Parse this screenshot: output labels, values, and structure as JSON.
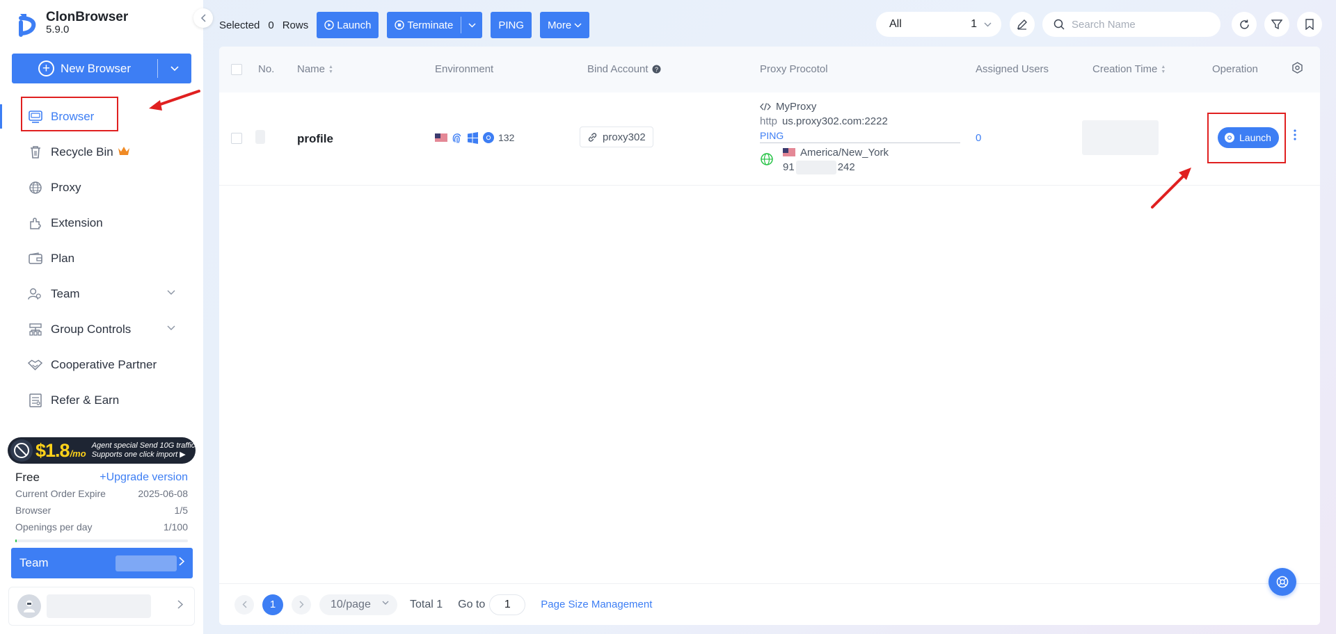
{
  "app": {
    "name": "ClonBrowser",
    "version": "5.9.0",
    "brand_color": "#3d7ef4",
    "collapse_icon": "chevron-left-icon"
  },
  "sidebar": {
    "new_browser_label": "New Browser",
    "items": [
      {
        "label": "Browser",
        "icon": "browser-icon",
        "active": true
      },
      {
        "label": "Recycle Bin",
        "icon": "trash-icon",
        "badge": "crown-icon"
      },
      {
        "label": "Proxy",
        "icon": "globe-icon"
      },
      {
        "label": "Extension",
        "icon": "puzzle-icon"
      },
      {
        "label": "Plan",
        "icon": "wallet-icon"
      },
      {
        "label": "Team",
        "icon": "team-icon",
        "expandable": true
      },
      {
        "label": "Group Controls",
        "icon": "hierarchy-icon",
        "expandable": true
      },
      {
        "label": "Cooperative Partner",
        "icon": "handshake-icon"
      },
      {
        "label": "Refer & Earn",
        "icon": "gift-icon"
      }
    ],
    "promo": {
      "price": "$1.8",
      "unit": "/mo",
      "line1": "Agent special Send 10G traffic",
      "line2": "Supports one click import ▶"
    },
    "plan": {
      "name": "Free",
      "upgrade_label": "+Upgrade version",
      "rows": [
        {
          "label": "Current Order Expire",
          "value": "2025-06-08"
        },
        {
          "label": "Browser",
          "value": "1/5"
        },
        {
          "label": "Openings per day",
          "value": "1/100"
        }
      ],
      "usage_fraction": 0.01
    },
    "team_label": "Team"
  },
  "toolbar": {
    "selected_label": "Selected",
    "selected_count": "0",
    "rows_label": "Rows",
    "launch_label": "Launch",
    "terminate_label": "Terminate",
    "ping_label": "PING",
    "more_label": "More",
    "filter_value": "All",
    "filter_count": "1",
    "search_placeholder": "Search Name"
  },
  "table": {
    "columns": {
      "no": "No.",
      "name": "Name",
      "environment": "Environment",
      "bind_account": "Bind Account",
      "proxy_protocol": "Proxy Procotol",
      "assigned_users": "Assigned Users",
      "creation_time": "Creation Time",
      "operation": "Operation"
    },
    "rows": [
      {
        "name": "profile",
        "env_version": "132",
        "bind_account": "proxy302",
        "proxy_name": "MyProxy",
        "proxy_type": "http",
        "proxy_host": "us.proxy302.com:2222",
        "ping_label": "PING",
        "timezone": "America/New_York",
        "ip_prefix": "91",
        "ip_suffix": "242",
        "assigned_users": "0",
        "launch_label": "Launch"
      }
    ]
  },
  "pagination": {
    "current_page": "1",
    "page_size": "10/page",
    "total": "Total 1",
    "goto_label": "Go to",
    "goto_value": "1",
    "page_size_management": "Page Size Management"
  }
}
